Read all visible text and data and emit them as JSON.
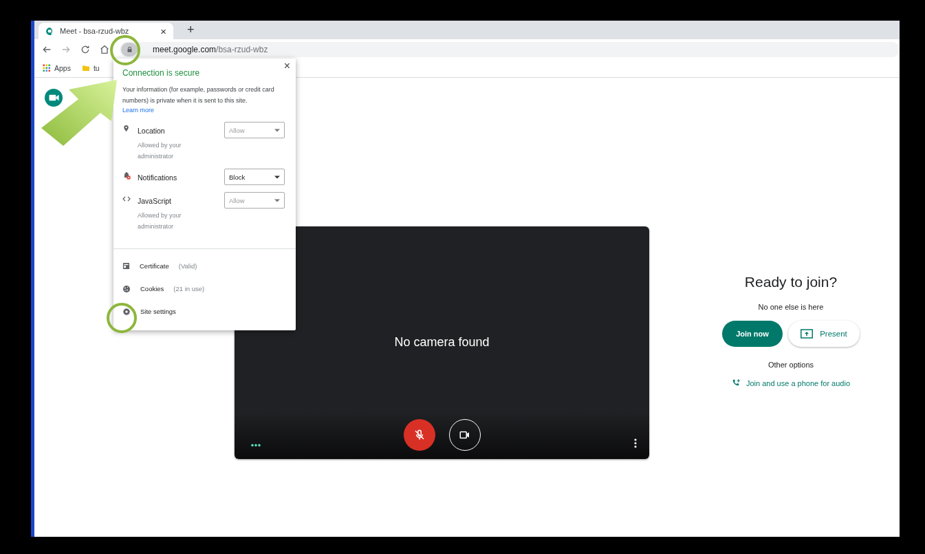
{
  "browser": {
    "tab": {
      "title": "Meet - bsa-rzud-wbz",
      "close": "×"
    },
    "new_tab": "+",
    "url": {
      "host": "meet.google.com",
      "path": "/bsa-rzud-wbz"
    },
    "bookmarks": [
      {
        "kind": "apps",
        "label": "Apps"
      },
      {
        "kind": "folder",
        "label": "tu"
      }
    ]
  },
  "site_info": {
    "close": "×",
    "title": "Connection is secure",
    "description": "Your information (for example, passwords or credit card numbers) is private when it is sent to this site.",
    "learn_more": "Learn more",
    "permissions": [
      {
        "kind": "location",
        "name": "Location",
        "value": "Allow",
        "disabled": true,
        "note": "Allowed by your administrator"
      },
      {
        "kind": "notifications",
        "name": "Notifications",
        "value": "Block",
        "disabled": false
      },
      {
        "kind": "javascript",
        "name": "JavaScript",
        "value": "Allow",
        "disabled": true,
        "note": "Allowed by your administrator"
      }
    ],
    "items": [
      {
        "kind": "certificate",
        "label": "Certificate",
        "detail": "(Valid)"
      },
      {
        "kind": "cookies",
        "label": "Cookies",
        "detail": "(21 in use)"
      },
      {
        "kind": "settings",
        "label": "Site settings"
      }
    ]
  },
  "preview": {
    "message": "No camera found",
    "mic_muted": true
  },
  "join": {
    "title": "Ready to join?",
    "status": "No one else is here",
    "primary": "Join now",
    "secondary": "Present",
    "other": "Other options",
    "phone": "Join and use a phone for audio"
  }
}
